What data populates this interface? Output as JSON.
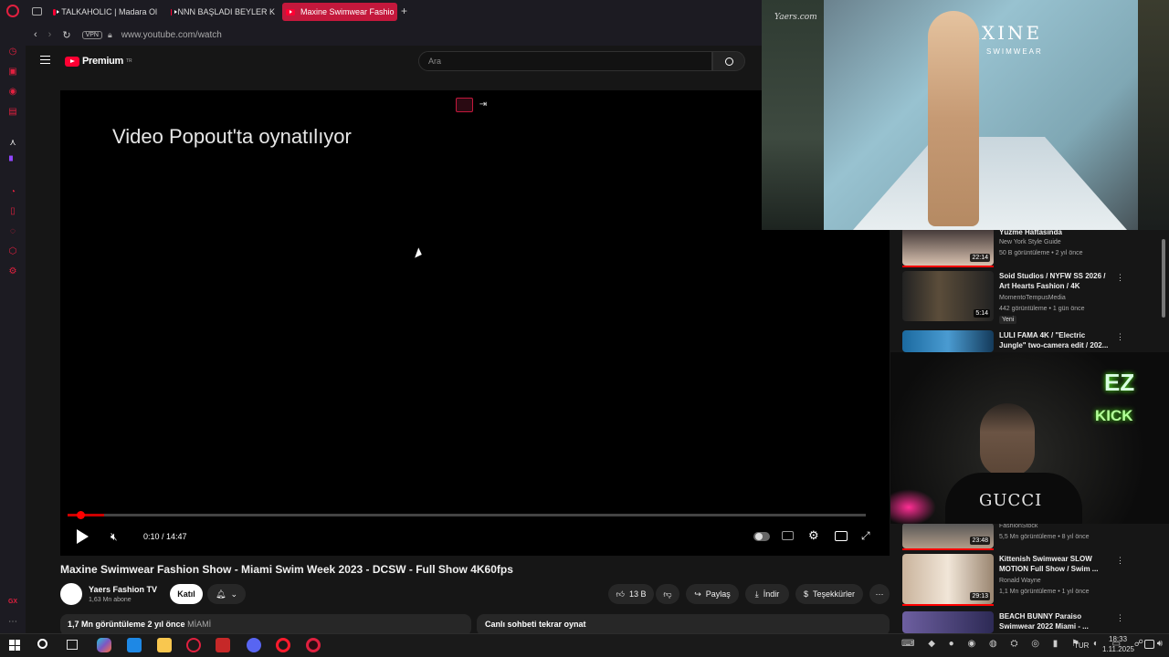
{
  "browser": {
    "tabs": [
      {
        "label": "TALKAHOLIC | Madara Ol"
      },
      {
        "label": "NNN BAŞLADI BEYLER K"
      },
      {
        "label": "Maxine Swimwear Fashio"
      }
    ],
    "new_tab": "+",
    "vpn": "VPN",
    "url": "www.youtube.com/watch"
  },
  "youtube": {
    "logo": "Premium",
    "logo_sup": "TR",
    "search_placeholder": "Ara",
    "popout_message": "Video Popout'ta oynatılıyor",
    "time": "0:10 / 14:47",
    "progress_fraction": 0.011,
    "title": "Maxine Swimwear Fashion Show - Miami Swim Week 2023 - DCSW - Full Show 4K60fps",
    "channel": "Yaers Fashion TV",
    "subscribers": "1,63 Mn abone",
    "join": "Katıl",
    "likes": "13 B",
    "share": "Paylaş",
    "download": "İndir",
    "thanks": "Teşekkürler",
    "views": "1,7 Mn görüntüleme",
    "age": "2 yıl önce",
    "tag": "MİAMİ",
    "chat_replay": "Canlı sohbeti tekrar oynat"
  },
  "recommended": [
    {
      "title": "Yüzme Haftasında",
      "channel": "New York Style Guide",
      "meta": "50 B görüntüleme • 2 yıl önce",
      "duration": "22:14"
    },
    {
      "title": "Soid Studios / NYFW SS 2026 / Art Hearts Fashion / 4K",
      "channel": "MomentoTempusMedia",
      "meta": "442 görüntüleme • 1 gün önce",
      "badge": "Yeni",
      "duration": "5:14"
    },
    {
      "title": "LULI FAMA 4K / \"Electric Jungle\" two-camera edit / 202...",
      "channel": "",
      "meta": "",
      "duration": ""
    },
    {
      "title": "",
      "channel": "FashionStock",
      "meta": "5,5 Mn görüntüleme • 8 yıl önce",
      "duration": "23:48"
    },
    {
      "title": "Kittenish Swimwear SLOW MOTION Full Show / Swim ...",
      "channel": "Ronald Wayne",
      "meta": "1,1 Mn görüntüleme • 1 yıl önce",
      "duration": "29:13"
    },
    {
      "title": "BEACH BUNNY Paraiso Swimwear 2022 Miami - ...",
      "channel": "",
      "meta": "",
      "duration": ""
    }
  ],
  "pip": {
    "watermark": "Yaers.com",
    "brand": "MAXINE",
    "sub": "SWIMWEAR"
  },
  "webcam": {
    "sign_top": "EZ",
    "sign_bottom": "KICK",
    "shirt": "GUCCI"
  },
  "taskbar": {
    "time": "18:33",
    "date": "1.11.2025",
    "lang": "TUR"
  },
  "colors": {
    "accent": "#c4183c",
    "yt_red": "#ff0033",
    "kick_green": "#53fc18"
  }
}
